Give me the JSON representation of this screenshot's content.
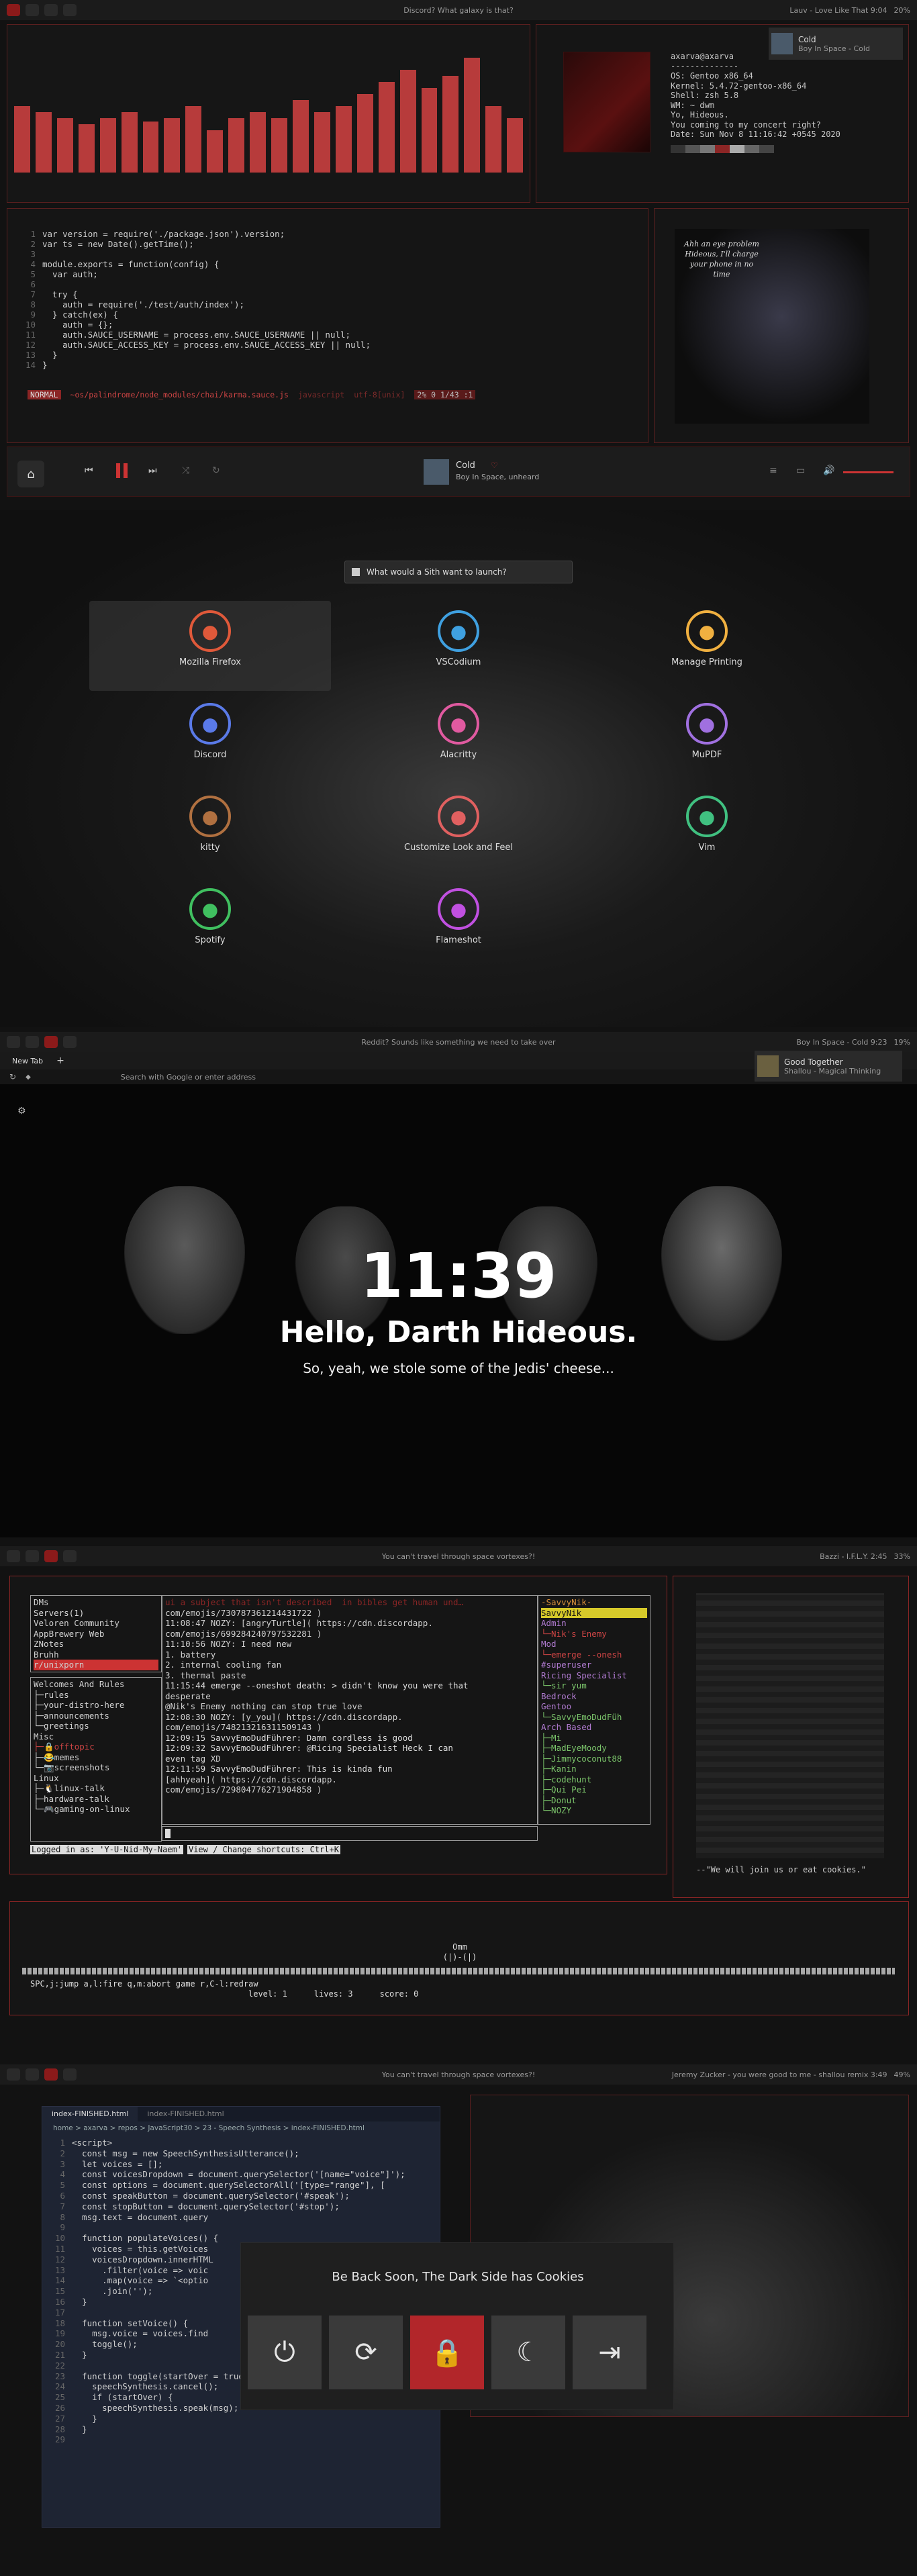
{
  "section1": {
    "topbar_title": "Discord? What galaxy is that?",
    "topbar_right": "Lauv - Love Like That 9:04",
    "battery": "20%",
    "bars": [
      0.55,
      0.5,
      0.45,
      0.4,
      0.45,
      0.5,
      0.42,
      0.45,
      0.55,
      0.35,
      0.45,
      0.5,
      0.45,
      0.6,
      0.5,
      0.55,
      0.65,
      0.75,
      0.85,
      0.7,
      0.8,
      0.95,
      0.55,
      0.45
    ],
    "neofetch": {
      "user": "axarva@axarva",
      "sep": "--------------",
      "os": "OS: Gentoo x86_64",
      "kernel": "Kernel: 5.4.72-gentoo-x86_64",
      "shell": "Shell: zsh 5.8",
      "wm": "WM: ~ dwm",
      "l1": "Yo, Hideous.",
      "l2": "You coming to my concert right?",
      "date": "Date: Sun Nov 8 11:16:42 +0545 2020"
    },
    "song_card": {
      "title": "Cold",
      "artist": "Boy In Space - Cold"
    },
    "code_lines": [
      "var version = require('./package.json').version;",
      "var ts = new Date().getTime();",
      "",
      "module.exports = function(config) {",
      "  var auth;",
      "",
      "  try {",
      "    auth = require('./test/auth/index');",
      "  } catch(ex) {",
      "    auth = {};",
      "    auth.SAUCE_USERNAME = process.env.SAUCE_USERNAME || null;",
      "    auth.SAUCE_ACCESS_KEY = process.env.SAUCE_ACCESS_KEY || null;",
      "  }",
      "}"
    ],
    "statusline": {
      "mode": "NORMAL",
      "path": "~os/palindrome/node_modules/chai/karma.sauce.js",
      "filetype": "javascript",
      "enc": "utf-8[unix]",
      "pos": "2% 0 1/43 :1"
    },
    "emperor_text": "Ahh an eye problem\nHideous, I'll charge\nyour phone in no\ntime",
    "player": {
      "title": "Cold",
      "subtitle": "Boy In Space, unheard"
    }
  },
  "section2": {
    "search_placeholder": "What would a Sith want to launch?",
    "apps": [
      {
        "name": "Mozilla Firefox",
        "icon": "firefox-icon",
        "color": "#e0593a"
      },
      {
        "name": "VSCodium",
        "icon": "vscodium-icon",
        "color": "#3fa0e0"
      },
      {
        "name": "Manage Printing",
        "icon": "printer-icon",
        "color": "#f0b040"
      },
      {
        "name": "Discord",
        "icon": "discord-icon",
        "color": "#5a7ae8"
      },
      {
        "name": "Alacritty",
        "icon": "alacritty-icon",
        "color": "#e05aa0"
      },
      {
        "name": "MuPDF",
        "icon": "pdf-icon",
        "color": "#a070e0"
      },
      {
        "name": "kitty",
        "icon": "kitty-icon",
        "color": "#b07040"
      },
      {
        "name": "Customize Look and Feel",
        "icon": "brush-icon",
        "color": "#e06060"
      },
      {
        "name": "Vim",
        "icon": "vim-icon",
        "color": "#40c080"
      },
      {
        "name": "Spotify",
        "icon": "spotify-icon",
        "color": "#40c060"
      },
      {
        "name": "Flameshot",
        "icon": "flameshot-icon",
        "color": "#c050e0"
      }
    ]
  },
  "section3": {
    "topbar_title": "Reddit? Sounds like something we need to take over",
    "topbar_right": "Boy In Space - Cold 9:23",
    "battery": "19%",
    "tab_label": "New Tab",
    "url_placeholder": "Search with Google or enter address",
    "song_card": {
      "title": "Good Together",
      "artist": "Shallou - Magical Thinking"
    },
    "time": "11:39",
    "greeting": "Hello, Darth Hideous.",
    "subgreeting": "So, yeah, we stole some of the Jedis' cheese..."
  },
  "section4": {
    "topbar_title": "You can't travel through space vortexes?!",
    "topbar_right": "Bazzi - I.F.L.Y. 2:45",
    "battery": "33%",
    "servers": [
      "DMs",
      "Servers(1)",
      "Veloren Community",
      "AppBrewery Web",
      "ZNotes",
      "Bruhh",
      "r/unixporn"
    ],
    "channels": [
      "Welcomes And Rules",
      "├─rules",
      "├─your-distro-here",
      "├─announcements",
      "└─greetings",
      "Misc",
      "├─🔒offtopic",
      "├─😂memes",
      "└─📷screenshots",
      "Linux",
      "├─🐧linux-talk",
      "├─hardware-talk",
      "└─🎮gaming-on-linux"
    ],
    "messages": [
      "ui a subject that isn't described  in bibles get human und…",
      "com/emojis/730787361214431722 )",
      "11:08:47 NOZY: [angryTurtle]( https://cdn.discordapp.",
      "com/emojis/699284240797532281 )",
      "11:10:56 NOZY: I need new",
      "1. battery",
      "2. internal cooling fan",
      "3. thermal paste",
      "11:15:44 emerge --oneshot death: > didn't know you were that",
      "desperate",
      "@Nik's Enemy nothing can stop true love",
      "12:08:30 NOZY: [y_you]( https://cdn.discordapp.",
      "com/emojis/748213216311509143 )",
      "12:09:15 SavvyEmoDudFührer: Damn cordless is good",
      "12:09:32 SavvyEmoDudFührer: @Ricing Specialist Heck I can",
      "even tag XD",
      "12:11:59 SavvyEmoDudFührer: This is kinda fun",
      "[ahhyeah]( https://cdn.discordapp.",
      "com/emojis/729804776271904858 )"
    ],
    "members": [
      "-SavvyNik-",
      "SavvyNik",
      "Admin",
      "└─Nik's Enemy",
      "Mod",
      "└─emerge --onesh",
      "#superuser",
      "Ricing Specialist",
      "└─sir yum",
      "Bedrock",
      "Gentoo",
      "└─SavvyEmoDudFüh",
      "Arch Based",
      "├─Mi",
      "├─MadEyeMoody",
      "├─Jimmycoconut88",
      "├─Kanin",
      "├─codehunt",
      "├─Qui Pei",
      "├─Donut",
      "└─NOZY"
    ],
    "logged_in": "Logged in as: 'Y-U-Nid-My-Naem'",
    "shortcuts": "View / Change shortcuts: Ctrl+K",
    "ascii_quote": "--\"We will join us or eat cookies.\"",
    "game": {
      "player": "Omm",
      "ship": "(|)-(|)",
      "controls": "SPC,j:jump  a,l:fire  q,m:abort game  r,C-l:redraw",
      "level": "level: 1",
      "lives": "lives: 3",
      "score": "score: 0"
    }
  },
  "section5": {
    "topbar_title": "You can't travel through space vortexes?!",
    "topbar_right": "Jeremy Zucker - you were good to me - shallou remix 3:49",
    "battery": "49%",
    "tabs": [
      "index-FINISHED.html",
      "index-FINISHED.html"
    ],
    "breadcrumb": "home > axarva > repos > JavaScript30 > 23 - Speech Synthesis > index-FINISHED.html",
    "code_lines": [
      "<script>",
      "  const msg = new SpeechSynthesisUtterance();",
      "  let voices = [];",
      "  const voicesDropdown = document.querySelector('[name=\"voice\"]');",
      "  const options = document.querySelectorAll('[type=\"range\"], [",
      "  const speakButton = document.querySelector('#speak');",
      "  const stopButton = document.querySelector('#stop');",
      "  msg.text = document.query",
      "",
      "  function populateVoices() {",
      "    voices = this.getVoices",
      "    voicesDropdown.innerHTML",
      "      .filter(voice => voic",
      "      .map(voice => `<optio",
      "      .join('');",
      "  }",
      "",
      "  function setVoice() {",
      "    msg.voice = voices.find",
      "    toggle();",
      "  }",
      "",
      "  function toggle(startOver = true) {",
      "    speechSynthesis.cancel();",
      "    if (startOver) {",
      "      speechSynthesis.speak(msg);",
      "    }",
      "  }",
      ""
    ],
    "power_title": "Be Back Soon, The Dark Side has Cookies",
    "power_buttons": [
      {
        "icon": "power-icon",
        "glyph": "⏻"
      },
      {
        "icon": "reboot-icon",
        "glyph": "⟳"
      },
      {
        "icon": "lock-icon",
        "glyph": "🔒"
      },
      {
        "icon": "sleep-icon",
        "glyph": "☾"
      },
      {
        "icon": "logout-icon",
        "glyph": "⇥"
      }
    ]
  }
}
